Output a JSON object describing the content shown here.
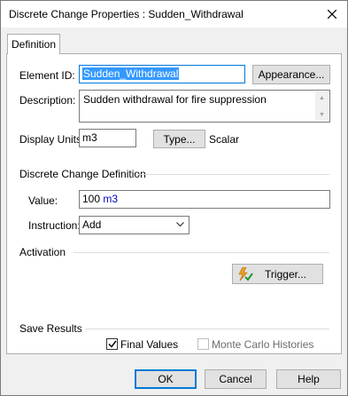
{
  "window": {
    "title": "Discrete Change Properties : Sudden_Withdrawal"
  },
  "tabs": [
    {
      "label": "Definition"
    }
  ],
  "element_id": {
    "label": "Element ID:",
    "value": "Sudden_Withdrawal",
    "appearance_button": "Appearance..."
  },
  "description": {
    "label": "Description:",
    "value": "Sudden withdrawal for fire suppression"
  },
  "display_units": {
    "label": "Display Units:",
    "value": "m3",
    "type_button": "Type...",
    "type_value": "Scalar"
  },
  "discrete_change": {
    "section_label": "Discrete Change Definition",
    "value_label": "Value:",
    "value_number": "100",
    "value_unit": "m3",
    "instruction_label": "Instruction:",
    "instruction_value": "Add"
  },
  "activation": {
    "section_label": "Activation",
    "trigger_button": "Trigger..."
  },
  "save_results": {
    "section_label": "Save Results",
    "final_values_label": "Final Values",
    "final_values_checked": true,
    "monte_carlo_label": "Monte Carlo Histories",
    "monte_carlo_checked": false,
    "monte_carlo_enabled": false
  },
  "footer": {
    "ok": "OK",
    "cancel": "Cancel",
    "help": "Help"
  }
}
